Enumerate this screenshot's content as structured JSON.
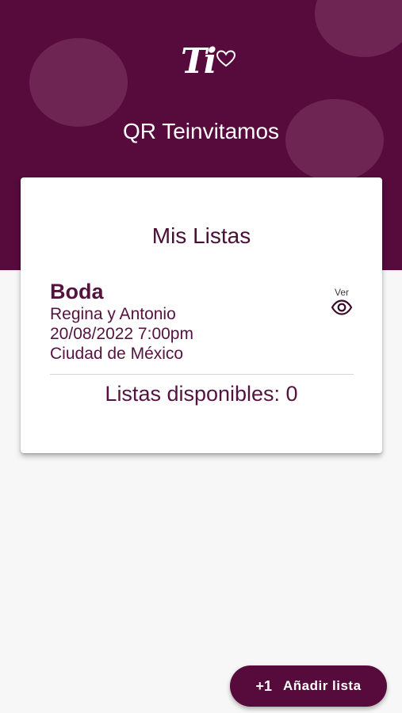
{
  "header": {
    "logo_text": "Ti",
    "app_title": "QR Teinvitamos"
  },
  "card": {
    "title": "Mis Listas",
    "items": [
      {
        "name": "Boda",
        "couple": "Regina y Antonio",
        "datetime": "20/08/2022 7:00pm",
        "location": "Ciudad de México",
        "view_label": "Ver",
        "view_icon": "eye-icon"
      }
    ],
    "available_text": "Listas disponibles: 0"
  },
  "fab": {
    "icon_text": "+1",
    "label": "Añadir lista"
  },
  "colors": {
    "brand": "#570a3c",
    "brand_light": "#6e2554",
    "text": "#56123f",
    "background": "#f7f7f8"
  }
}
